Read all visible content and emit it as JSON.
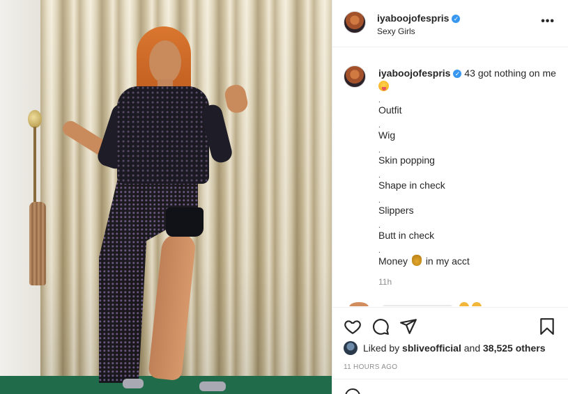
{
  "post": {
    "username": "iyaboojofespris",
    "verified_mark": "✓",
    "subtitle": "Sexy Girls",
    "more_label": "•••"
  },
  "caption": {
    "username": "iyaboojofespris",
    "text": "43 got nothing on me",
    "emoji_icon": "tongue-face-icon",
    "lines": [
      {
        "dot": ".",
        "text": "Outfit"
      },
      {
        "dot": ".",
        "text": "Wig"
      },
      {
        "dot": ".",
        "text": "Skin popping"
      },
      {
        "dot": ".",
        "text": "Shape in check"
      },
      {
        "dot": ".",
        "text": "Slippers"
      },
      {
        "dot": ".",
        "text": "Butt in check"
      },
      {
        "dot": ".",
        "text": "Money",
        "suffix": "in my acct"
      }
    ],
    "time": "11h"
  },
  "actions": {
    "liked_by_prefix": "Liked by",
    "liked_by_user": "sbliveofficial",
    "and_text": "and",
    "others_count": "38,525 others",
    "ago": "11 HOURS AGO"
  },
  "colors": {
    "verified": "#3897f0",
    "muted": "#8e8e8e",
    "text": "#262626",
    "floor": "#1f6b4a"
  }
}
